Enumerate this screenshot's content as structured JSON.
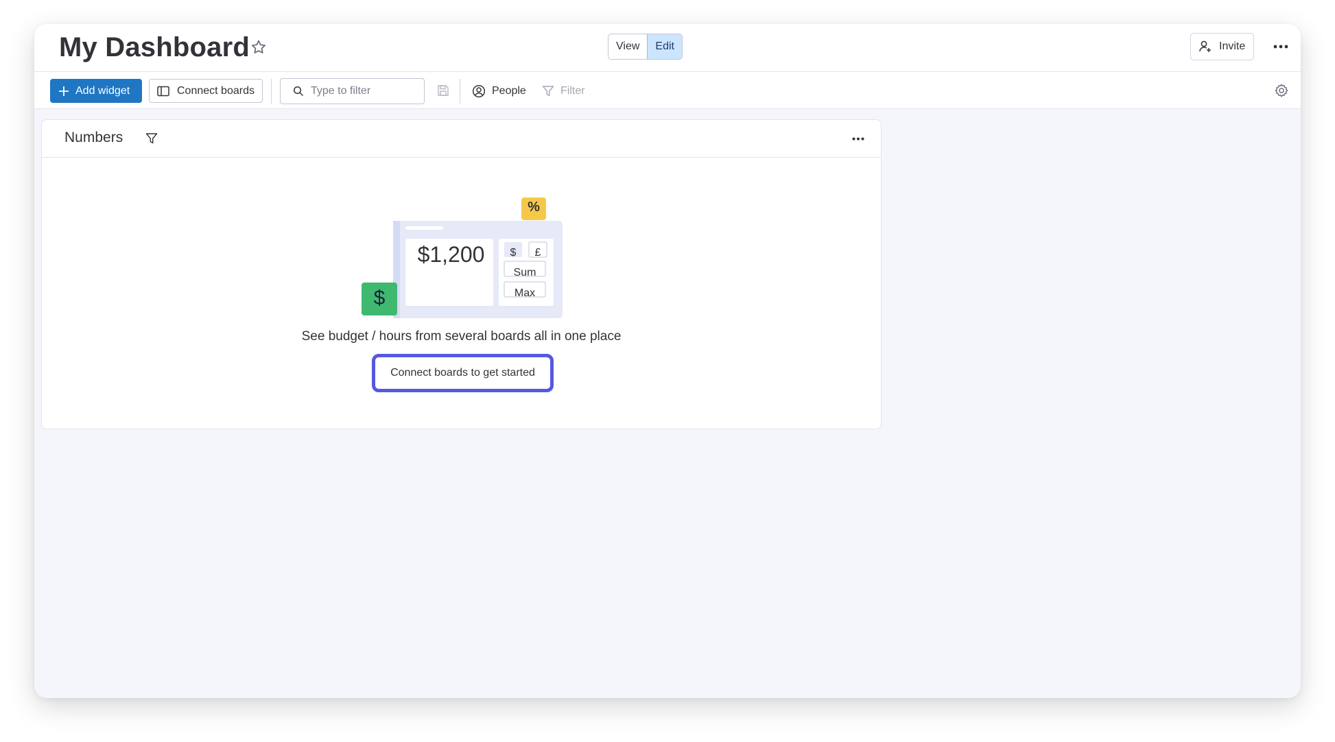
{
  "header": {
    "title": "My Dashboard",
    "view_label": "View",
    "edit_label": "Edit",
    "invite_label": "Invite"
  },
  "toolbar": {
    "add_widget_label": "Add widget",
    "connect_boards_label": "Connect boards",
    "search_placeholder": "Type to filter",
    "people_label": "People",
    "filter_label": "Filter"
  },
  "widget": {
    "title": "Numbers",
    "illustration": {
      "amount": "$1,200",
      "currency_tags": [
        "$",
        "£"
      ],
      "function_tags": [
        "Sum",
        "Max"
      ],
      "percent_badge": "%",
      "dollar_badge": "$"
    },
    "tagline": "See budget / hours from several boards all in one place",
    "cta_label": "Connect boards to get started"
  },
  "colors": {
    "primary_blue": "#1f76c2",
    "focus_ring": "#5559df",
    "edit_active": "#cce5ff",
    "green_badge": "#3fb970",
    "yellow_badge": "#f6c84a",
    "background": "#f5f6fb"
  }
}
